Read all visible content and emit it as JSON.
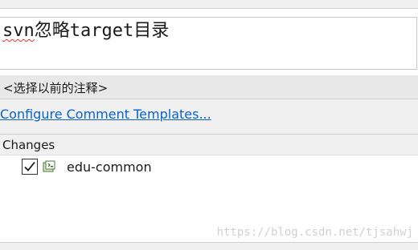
{
  "comment": {
    "prefix": "svn",
    "rest": "忽略target目录"
  },
  "recent_messages": {
    "label": "<选择以前的注释>"
  },
  "templates": {
    "link_label": "Configure Comment Templates..."
  },
  "changes": {
    "header": "Changes",
    "items": [
      {
        "label": "edu-common",
        "checked": true,
        "icon": "project-folder-icon"
      }
    ]
  },
  "watermark": "https://blog.csdn.net/tjsahwj",
  "colors": {
    "link": "#0a62c4",
    "panel": "#f0f0f0",
    "recent_bar": "#e8e8e8"
  }
}
